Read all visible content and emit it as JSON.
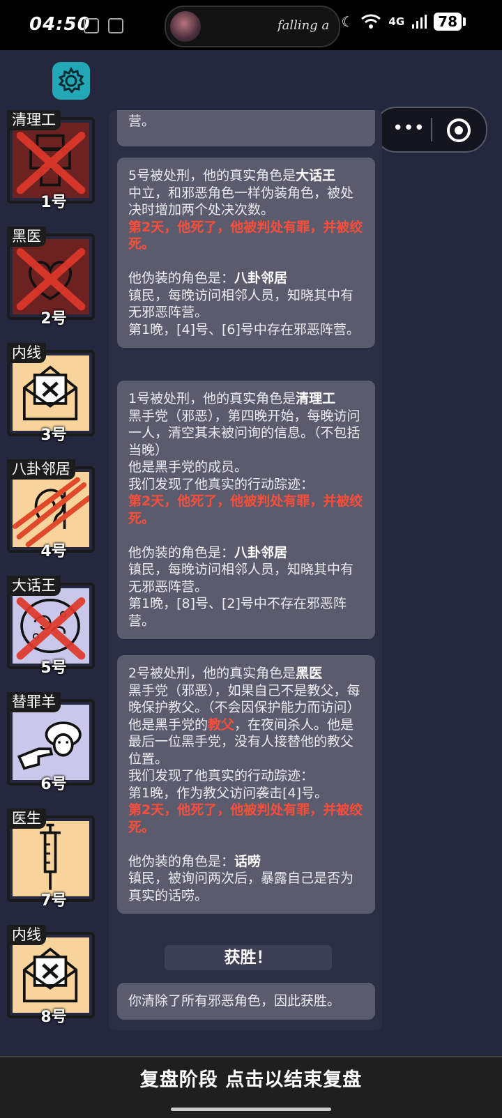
{
  "status_bar": {
    "time": "04:50",
    "song": "falling a",
    "signal": "4G",
    "battery": "78"
  },
  "capsule": {
    "more_icon": "more-dots-icon",
    "close_icon": "target-icon"
  },
  "players": [
    {
      "role": "清理工",
      "number": "1号",
      "icon": "printer",
      "dead": true,
      "bg": "#6b2221"
    },
    {
      "role": "黑医",
      "number": "2号",
      "icon": "heart",
      "dead": true,
      "bg": "#6b2221"
    },
    {
      "role": "内线",
      "number": "3号",
      "icon": "envelope-x",
      "dead": false,
      "bg": "#f8d49c"
    },
    {
      "role": "八卦邻居",
      "number": "4号",
      "icon": "ear-slash",
      "dead": false,
      "bg": "#f8d49c"
    },
    {
      "role": "大话王",
      "number": "5号",
      "icon": "brain",
      "dead": true,
      "bg": "#c9c8ea"
    },
    {
      "role": "替罪羊",
      "number": "6号",
      "icon": "sheep-hand",
      "dead": false,
      "bg": "#c9c8ea"
    },
    {
      "role": "医生",
      "number": "7号",
      "icon": "syringe",
      "dead": false,
      "bg": "#f8d49c"
    },
    {
      "role": "内线",
      "number": "8号",
      "icon": "envelope-x",
      "dead": false,
      "bg": "#f8d49c"
    }
  ],
  "log": {
    "partial_top": "营。",
    "entry1": {
      "l1": "5号被处刑，他的真实角色是",
      "role": "大话王",
      "l2": "中立，和邪恶角色一样伪装角色，被处决时增加两个处决次数。",
      "red": "第2天，他死了，他被判处有罪，并被绞死。",
      "fake_label": "他伪装的角色是：",
      "fake_role": "八卦邻居",
      "fake_desc": "镇民，每晚访问相邻人员，知晓其中有无邪恶阵营。",
      "night": "第1晚，[4]号、[6]号中存在邪恶阵营。"
    },
    "entry2": {
      "l1": "1号被处刑，他的真实角色是",
      "role": "清理工",
      "l2": "黑手党（邪恶），第四晚开始，每晚访问一人，清空其未被问询的信息。（不包括当晚）",
      "l3": "他是黑手党的成员。",
      "l4": "我们发现了他真实的行动踪迹：",
      "red": "第2天，他死了，他被判处有罪，并被绞死。",
      "fake_label": "他伪装的角色是：",
      "fake_role": "八卦邻居",
      "fake_desc": "镇民，每晚访问相邻人员，知晓其中有无邪恶阵营。",
      "night": "第1晚，[8]号、[2]号中不存在邪恶阵营。"
    },
    "entry3": {
      "l1": "2号被处刑，他的真实角色是",
      "role": "黑医",
      "l2": "黑手党（邪恶），如果自己不是教父，每晚保护教父。（不会因保护能力而访问）",
      "l3a": "他是黑手党的",
      "l3b": "教父",
      "l3c": "，在夜间杀人。他是最后一位黑手党，没有人接替他的教父位置。",
      "l4": "我们发现了他真实的行动踪迹：",
      "l5": "第1晚，作为教父访问袭击[4]号。",
      "red": "第2天，他死了，他被判处有罪，并被绞死。",
      "fake_label": "他伪装的角色是：",
      "fake_role": "话唠",
      "fake_desc": "镇民，被询问两次后，暴露自己是否为真实的话唠。"
    },
    "win_title": "获胜！",
    "win_text": "你清除了所有邪恶角色，因此获胜。"
  },
  "bottom": {
    "label": "复盘阶段 点击以结束复盘"
  }
}
